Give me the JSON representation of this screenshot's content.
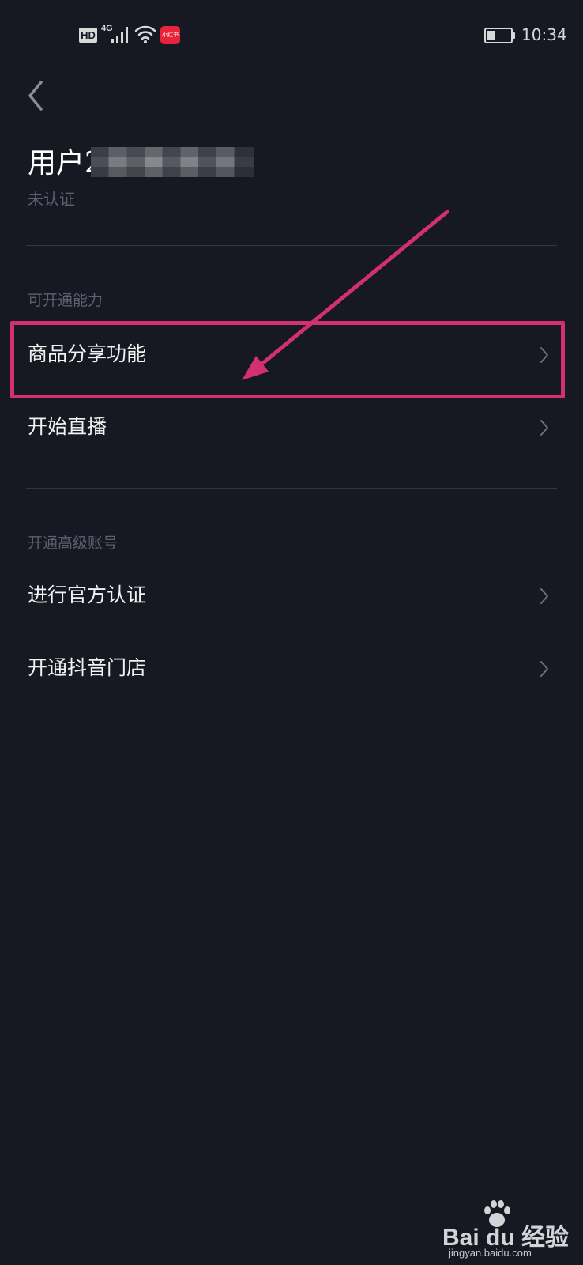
{
  "status_bar": {
    "hd": "HD",
    "network": "4G",
    "app_badge": "小红书",
    "time": "10:34",
    "icons": [
      "signal-icon",
      "wifi-icon",
      "battery-icon"
    ]
  },
  "header": {
    "back_icon": "chevron-left-icon",
    "user_name": "用户22",
    "verify_status": "未认证"
  },
  "sections": [
    {
      "title": "可开通能力",
      "items": [
        {
          "label": "商品分享功能",
          "icon": "chevron-right-icon"
        },
        {
          "label": "开始直播",
          "icon": "chevron-right-icon"
        }
      ]
    },
    {
      "title": "开通高级账号",
      "items": [
        {
          "label": "进行官方认证",
          "icon": "chevron-right-icon"
        },
        {
          "label": "开通抖音门店",
          "icon": "chevron-right-icon"
        }
      ]
    }
  ],
  "annotation": {
    "color": "#d3306f"
  },
  "watermark": {
    "brand": "Bai du 经验",
    "url": "jingyan.baidu.com"
  },
  "colors": {
    "background": "#161822",
    "divider": "#34363f",
    "secondary_text": "#5e6070",
    "primary_text": "#f2f2f2"
  }
}
